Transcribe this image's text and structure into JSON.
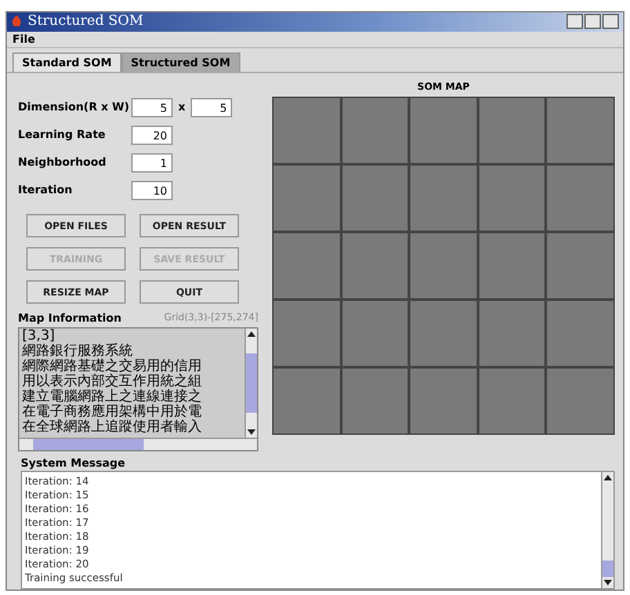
{
  "window": {
    "title": "Structured SOM"
  },
  "menu": [
    "File"
  ],
  "tabs": [
    {
      "label": "Standard SOM",
      "selected": true
    },
    {
      "label": "Structured SOM",
      "selected": false
    }
  ],
  "params": [
    {
      "label": "Dimension(R x W)",
      "value": "5",
      "separator": "x",
      "value2": "5"
    },
    {
      "label": "Learning Rate",
      "value": "20"
    },
    {
      "label": "Neighborhood",
      "value": "1"
    },
    {
      "label": "Iteration",
      "value": "10"
    }
  ],
  "buttons": [
    {
      "label": "OPEN FILES",
      "disabled": false
    },
    {
      "label": "OPEN RESULT",
      "disabled": false
    },
    {
      "label": "TRAINING",
      "disabled": true
    },
    {
      "label": "SAVE RESULT",
      "disabled": true
    },
    {
      "label": "RESIZE MAP",
      "disabled": false
    },
    {
      "label": "QUIT",
      "disabled": false
    }
  ],
  "map_info": {
    "title": "Map Information",
    "coords": "Grid(3,3)-[275,274]",
    "lines": [
      "[3,3]",
      "網路銀行服務系統",
      "網際網路基礎之交易用的信用",
      "用以表示內部交互作用統之組",
      "建立電腦網路上之連線連接之",
      "在電子商務應用架構中用於電",
      "在全球網路上追蹤使用者輸入"
    ]
  },
  "som_map": {
    "title": "SOM MAP",
    "cells": [
      {
        "kind": "node"
      },
      {
        "kind": "node"
      },
      {
        "kind": "node"
      },
      {
        "kind": "node"
      },
      {
        "kind": "node"
      },
      {
        "kind": "node"
      },
      {
        "kind": "node"
      },
      {
        "kind": "node"
      },
      {
        "kind": "node"
      },
      {
        "kind": "node"
      },
      {
        "kind": "node"
      },
      {
        "kind": "node"
      },
      {
        "kind": "node"
      },
      {
        "kind": "node"
      },
      {
        "kind": "node"
      },
      {
        "kind": "node"
      },
      {
        "kind": "node"
      },
      {
        "kind": "node"
      },
      {
        "kind": "node"
      },
      {
        "kind": "node"
      },
      {
        "kind": "node"
      },
      {
        "kind": "node"
      },
      {
        "kind": "node"
      },
      {
        "kind": "node"
      },
      {
        "kind": "node"
      }
    ]
  },
  "system_message": {
    "title": "System Message",
    "lines": [
      "Iteration: 14",
      "Iteration: 15",
      "Iteration: 16",
      "Iteration: 17",
      "Iteration: 18",
      "Iteration: 19",
      "Iteration: 20",
      "Training successful"
    ]
  }
}
